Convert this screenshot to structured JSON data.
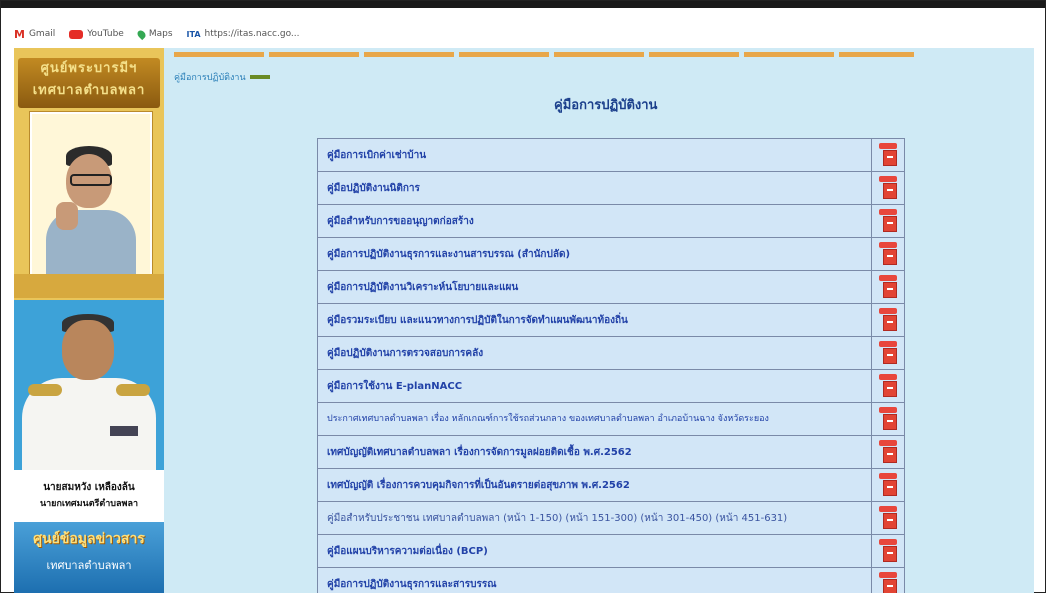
{
  "bookmarks": [
    {
      "label": "Gmail",
      "icon": "gmail-icon"
    },
    {
      "label": "YouTube",
      "icon": "youtube-icon"
    },
    {
      "label": "Maps",
      "icon": "maps-icon"
    },
    {
      "label": "https://itas.nacc.go...",
      "icon": "ita-icon"
    }
  ],
  "sidebar": {
    "banner_top_line1": "ศูนย์พระบารมีฯ",
    "banner_top_line2": "เทศบาลตำบลพลา",
    "person_name": "นายสมหวัง เหลืองล้น",
    "person_title": "นายกเทศมนตรีตำบลพลา",
    "banner_bottom_line1": "ศูนย์ข้อมูลข่าวสาร",
    "banner_bottom_line2": "เทศบาลตำบลพลา"
  },
  "breadcrumb": "คู่มือการปฏิบัติงาน",
  "page_title": "คู่มือการปฏิบัติงาน",
  "documents": [
    {
      "label": "คู่มือการเบิกค่าเช่าบ้าน",
      "style": "bold"
    },
    {
      "label": "คู่มือปฏิบัติงานนิติการ",
      "style": "bold"
    },
    {
      "label": "คู่มือสำหรับการขออนุญาตก่อสร้าง",
      "style": "bold"
    },
    {
      "label": "คู่มือการปฏิบัติงานธุรการและงานสารบรรณ (สำนักปลัด)",
      "style": "bold"
    },
    {
      "label": "คู่มือการปฏิบัติงานวิเคราะห์นโยบายและแผน",
      "style": "bold"
    },
    {
      "label": "คู่มือรวมระเบียบ และแนวทางการปฏิบัติในการจัดทำแผนพัฒนาท้องถิ่น",
      "style": "bold"
    },
    {
      "label": "คู่มือปฏิบัติงานการตรวจสอบการคลัง",
      "style": "bold"
    },
    {
      "label": "คู่มือการใช้งาน E-planNACC",
      "style": "bold"
    },
    {
      "label": "ประกาศเทศบาลตำบลพลา เรื่อง หลักเกณฑ์การใช้รถส่วนกลาง ของเทศบาลตำบลพลา อำเภอบ้านฉาง จังหวัดระยอง",
      "style": "small"
    },
    {
      "label": "เทศบัญญัติเทศบาลตำบลพลา เรื่องการจัดการมูลฝอยติดเชื้อ พ.ศ.2562",
      "style": "bold"
    },
    {
      "label": "เทศบัญญัติ เรื่องการควบคุมกิจการที่เป็นอันตรายต่อสุขภาพ พ.ศ.2562",
      "style": "bold"
    },
    {
      "label": "คู่มือสำหรับประชาชน เทศบาลตำบลพลา  (หน้า 1-150)  (หน้า 151-300)  (หน้า 301-450)  (หน้า 451-631)",
      "style": "plain"
    },
    {
      "label": "คู่มือแผนบริหารความต่อเนื่อง (BCP)",
      "style": "bold"
    },
    {
      "label": "คู่มือการปฏิบัติงานธุรการและสารบรรณ",
      "style": "bold"
    }
  ],
  "colors": {
    "page_bg": "#cfeaf5",
    "link": "#2242a8",
    "title": "#1b3f8c",
    "pdf_red": "#e24434"
  }
}
